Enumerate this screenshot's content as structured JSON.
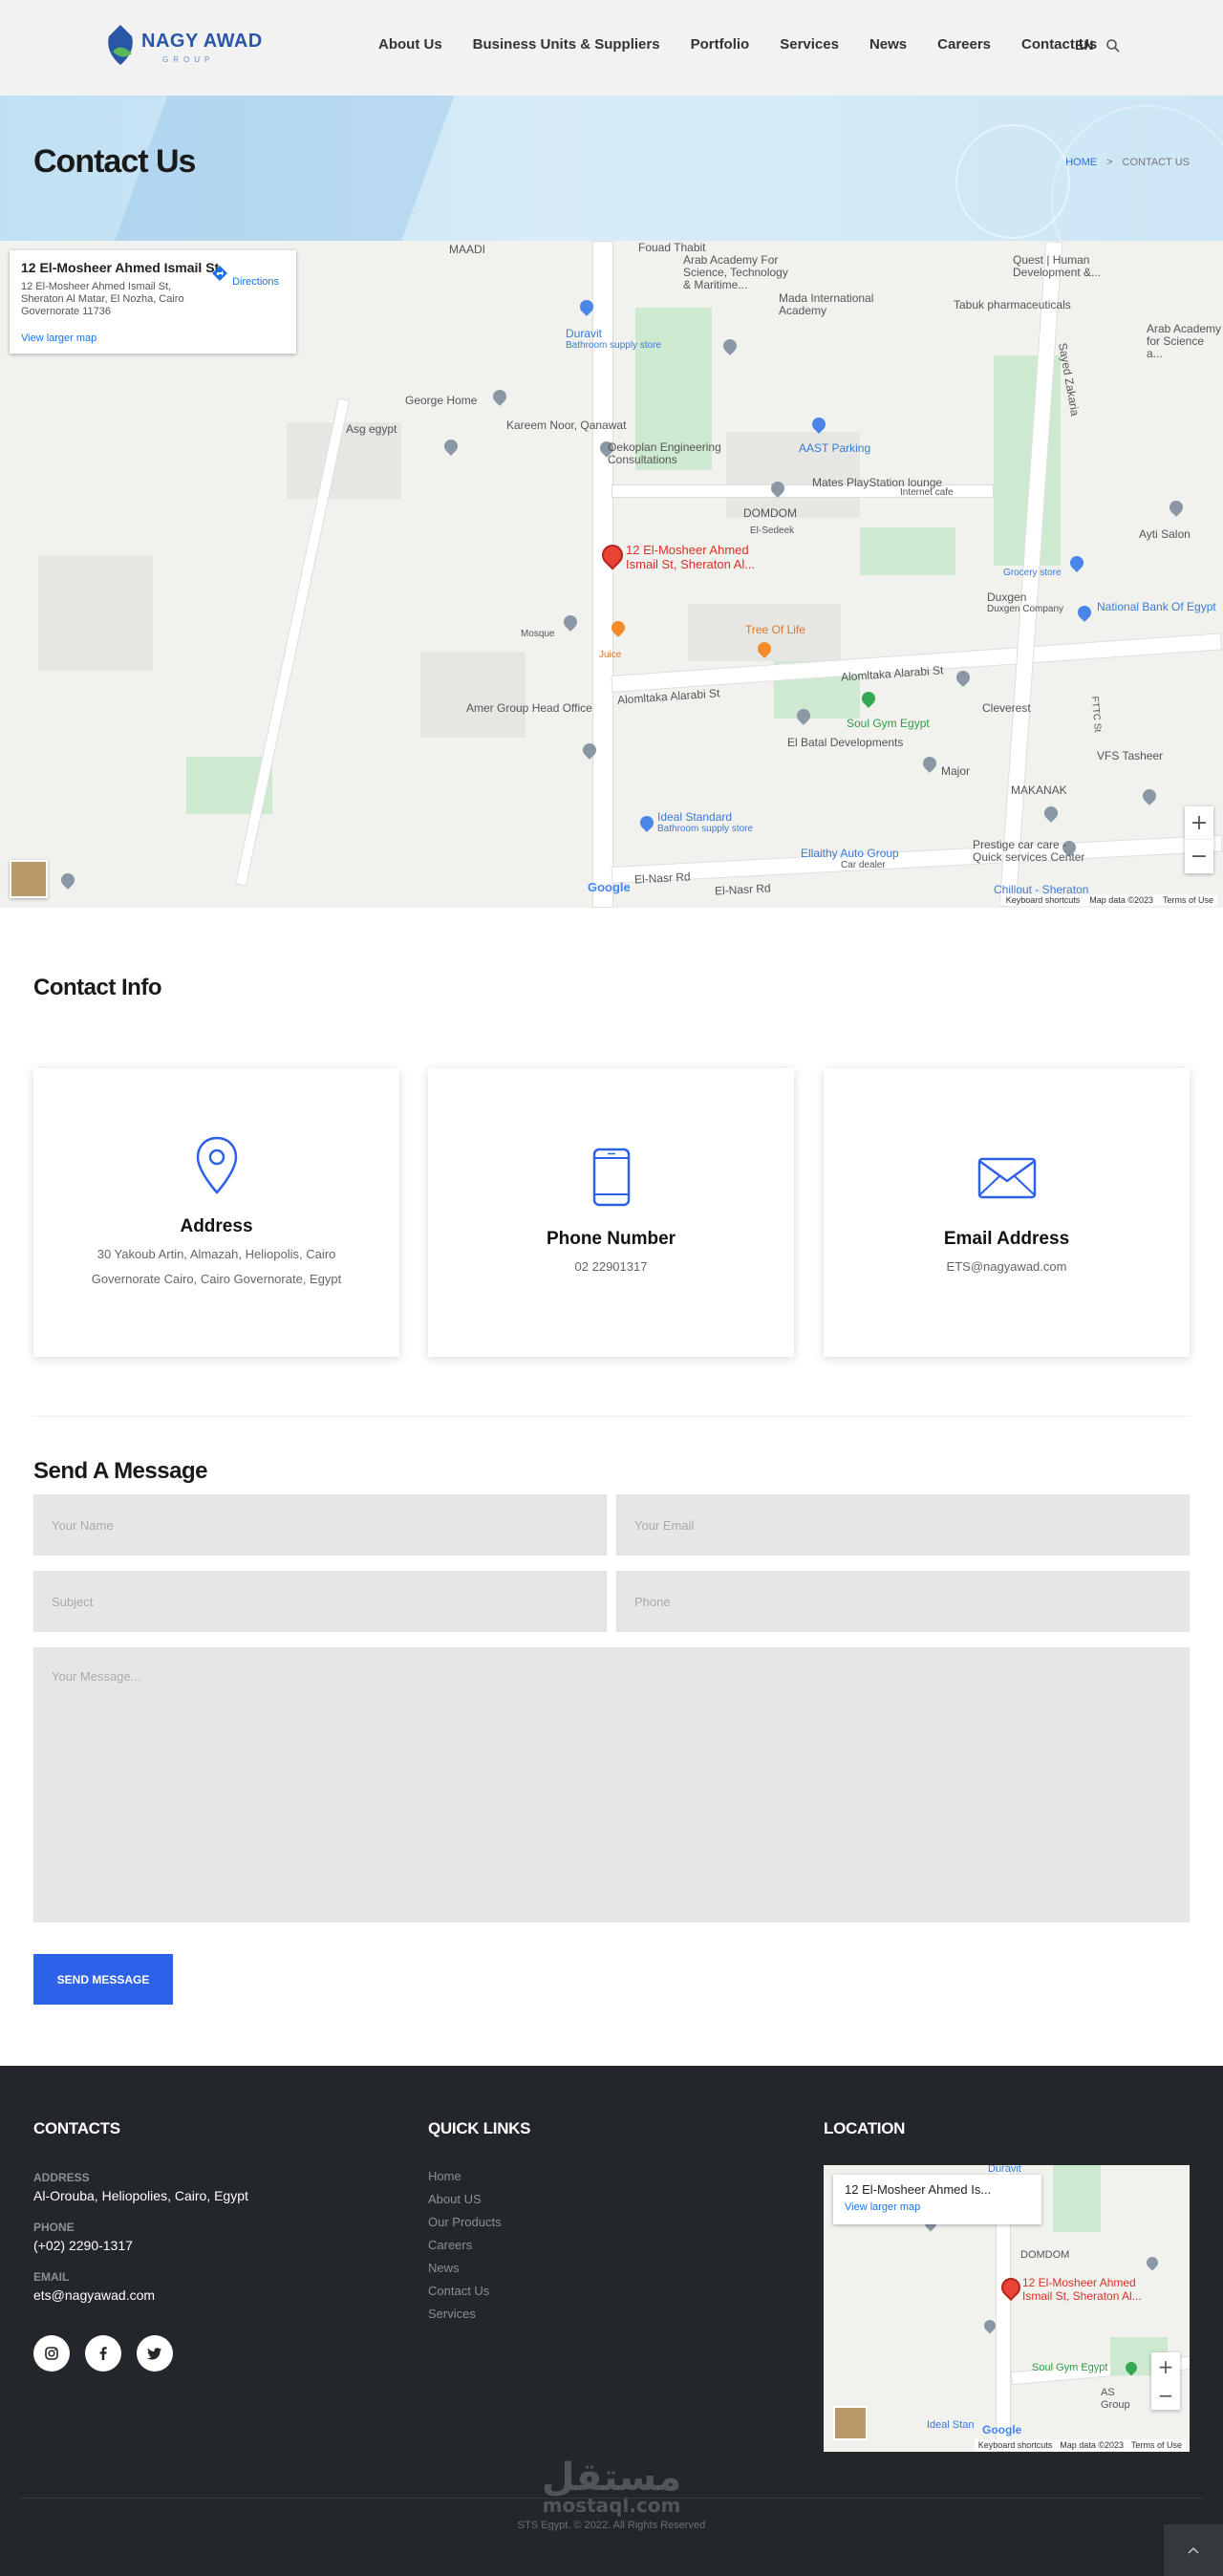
{
  "header": {
    "logo_text": "NAGY AWAD",
    "logo_sub": "GROUP",
    "nav": [
      "About Us",
      "Business Units & Suppliers",
      "Portfolio",
      "Services",
      "News",
      "Careers",
      "Contact Us"
    ],
    "lang": "EN"
  },
  "banner": {
    "title": "Contact Us",
    "breadcrumb_home": "HOME",
    "breadcrumb_sep": ">",
    "breadcrumb_current": "CONTACT US"
  },
  "map": {
    "card_place": "12 El-Mosheer Ahmed Ismail St",
    "card_address": "12 El-Mosheer Ahmed Ismail St, Sheraton Al Matar, El Nozha, Cairo Governorate 11736",
    "card_directions": "Directions",
    "card_larger": "View larger map",
    "pin_label_1": "12 El-Mosheer Ahmed",
    "pin_label_2": "Ismail St, Sheraton Al...",
    "labels": {
      "l1": "Arab Academy For Science, Technology & Maritime...",
      "l2": "Mada International Academy",
      "l3": "Tabuk pharmaceuticals",
      "l4": "Duravit",
      "l5": "Bathroom supply store",
      "l6": "George Home",
      "l7": "Kareem Noor, Qanawat",
      "l8": "Asg egypt",
      "l9": "Oekoplan Engineering Consultations",
      "l10": "AAST Parking",
      "l11": "Mates PlayStation lounge",
      "l12": "DOMDOM",
      "l13": "Tree Of Life",
      "l14": "Duxgen",
      "l15": "National Bank Of Egypt",
      "l16": "Amer Group Head Office",
      "l17": "Alomltaka Alarabi St",
      "l18": "Soul Gym Egypt",
      "l19": "Cleverest",
      "l20": "El Batal Developments",
      "l21": "Major",
      "l22": "MAKANAK",
      "l23": "VFS Tasheer",
      "l24": "Ideal Standard",
      "l25": "Ellaithy Auto Group",
      "l26": "Prestige car care - Quick services Center",
      "l27": "Chillout - Sheraton",
      "l28": "El-Nasr Rd",
      "l29": "Ayti Salon",
      "l30": "Sayed Zakaria",
      "l31": "Juice",
      "l32": "Quest | Human Development &...",
      "l33": "MAADI",
      "l34": "El-Sedeek",
      "l35": "Fouad Thabit",
      "l36": "FTTC St",
      "l37": "Grocery store",
      "l38": "Bathroom supply store",
      "l39": "Internet cafe",
      "l40": "Duxgen Company",
      "l41": "Car dealer",
      "l42": "Mosque",
      "l43": "Arab Academy for Science a..."
    },
    "footer_shortcuts": "Keyboard shortcuts",
    "footer_data": "Map data ©2023",
    "footer_terms": "Terms of Use",
    "google": "Google",
    "zoom_in": "+",
    "zoom_out": "−"
  },
  "contact_info": {
    "title": "Contact Info",
    "address_title": "Address",
    "address_text": "30 Yakoub Artin, Almazah, Heliopolis, Cairo Governorate Cairo, Cairo Governorate, Egypt",
    "phone_title": "Phone Number",
    "phone_text": "02 22901317",
    "email_title": "Email Address",
    "email_text": "ETS@nagyawad.com"
  },
  "form": {
    "title": "Send A Message",
    "name_placeholder": "Your Name",
    "email_placeholder": "Your Email",
    "subject_placeholder": "Subject",
    "phone_placeholder": "Phone",
    "message_placeholder": "Your Message...",
    "send_label": "SEND MESSAGE"
  },
  "footer": {
    "contacts_head": "CONTACTS",
    "address_label": "ADDRESS",
    "address_value": "Al-Oroubа, Heliopolies, Cairo, Egypt",
    "phone_label": "PHONE",
    "phone_value": "(+02) 2290-1317",
    "email_label": "EMAIL",
    "email_value": "ets@nagyawad.com",
    "links_head": "QUICK LINKS",
    "links": [
      "Home",
      "About US",
      "Our Products",
      "Careers",
      "News",
      "Contact Us",
      "Services"
    ],
    "location_head": "LOCATION",
    "map_card_place": "12 El-Mosheer Ahmed Is...",
    "map_card_larger": "View larger map",
    "map_pin_label_1": "12 El-Mosheer Ahmed",
    "map_pin_label_2": "Ismail St, Sheraton Al...",
    "map_labels": {
      "a": "Duravit",
      "b": "DOMDOM",
      "c": "Soul Gym Egypt",
      "d": "Ideal Stan",
      "e": "AS Group"
    },
    "map_footer_shortcuts": "Keyboard shortcuts",
    "map_footer_data": "Map data ©2023",
    "map_footer_terms": "Terms of Use",
    "watermark_ar": "مستقل",
    "watermark_en": "mostaql.com",
    "copyright": "STS Egypt. © 2022. All Rights Reserved"
  },
  "colors": {
    "accent": "#2d62e8",
    "footer_bg": "#23262b",
    "header_bg": "#f2f2f2"
  }
}
